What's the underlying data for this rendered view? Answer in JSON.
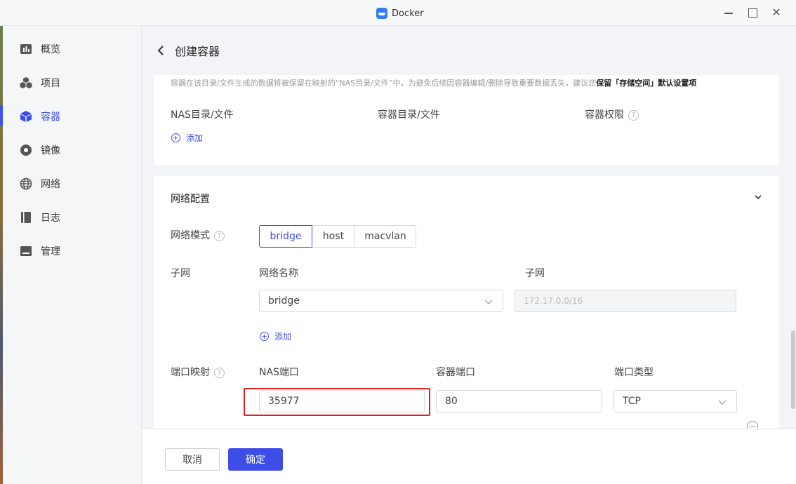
{
  "window": {
    "title": "Docker"
  },
  "sidebar": {
    "items": [
      {
        "label": "概览",
        "icon": "dashboard-icon",
        "active": false
      },
      {
        "label": "项目",
        "icon": "cubes-icon",
        "active": false
      },
      {
        "label": "容器",
        "icon": "box-icon",
        "active": true
      },
      {
        "label": "镜像",
        "icon": "disc-icon",
        "active": false
      },
      {
        "label": "网络",
        "icon": "globe-icon",
        "active": false
      },
      {
        "label": "日志",
        "icon": "book-icon",
        "active": false
      },
      {
        "label": "管理",
        "icon": "manage-icon",
        "active": false
      }
    ]
  },
  "header": {
    "title": "创建容器"
  },
  "volumes": {
    "hint_prefix": "容器在该目录/文件生成的数据将被保留在映射的“NAS目录/文件”中，为避免后续因容器编辑/删除导致重要数据丢失，建议您",
    "hint_bold": "保留「存储空间」默认设置项",
    "col_nas": "NAS目录/文件",
    "col_container": "容器目录/文件",
    "col_permission": "容器权限",
    "add_label": "添加"
  },
  "network": {
    "section_title": "网络配置",
    "mode_label": "网络模式",
    "modes": [
      "bridge",
      "host",
      "macvlan"
    ],
    "selected_mode": "bridge",
    "subnet_label": "子网",
    "col_network_name": "网络名称",
    "col_subnet": "子网",
    "network_name_value": "bridge",
    "subnet_value": "172.17.0.0/16",
    "add_label": "添加",
    "port_label": "端口映射",
    "col_nas_port": "NAS端口",
    "col_container_port": "容器端口",
    "col_port_type": "端口类型",
    "nas_port_value": "35977",
    "container_port_value": "80",
    "port_type_value": "TCP"
  },
  "footer": {
    "cancel_label": "取消",
    "ok_label": "确定"
  },
  "colors": {
    "accent": "#3d4de6",
    "highlight": "#e02020"
  }
}
